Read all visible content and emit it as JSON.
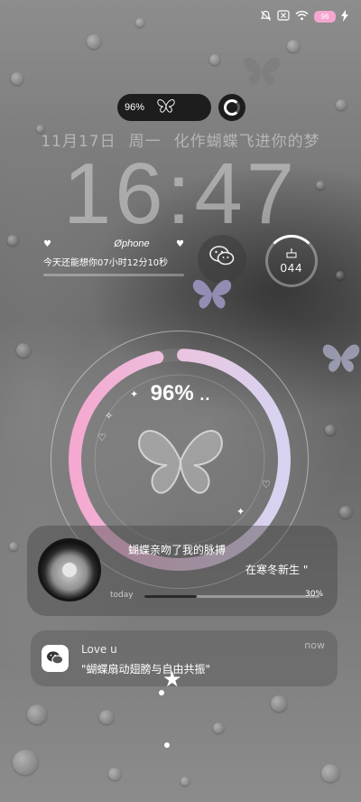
{
  "status_bar": {
    "icons": [
      "bell-muted-icon",
      "no-sim-icon",
      "wifi-icon",
      "battery-icon",
      "charging-icon"
    ],
    "battery_level": "96"
  },
  "pill": {
    "percent": "96%"
  },
  "date": {
    "date": "11月17日",
    "weekday": "周一",
    "slogan": "化作蝴蝶飞进你的梦"
  },
  "clock": {
    "time": "16:47"
  },
  "widget": {
    "title": "Øphone",
    "text": "今天还能想你07小时12分10秒"
  },
  "counter": {
    "value": "044"
  },
  "charging": {
    "percent": "96%",
    "dots": "..",
    "level": 0.96
  },
  "music": {
    "line1": "蝴蝶亲吻了我的脉搏",
    "line2": "在寒冬新生 \"",
    "today_label": "today",
    "progress_label": "30%",
    "progress": 0.3
  },
  "notification": {
    "title": "Love u",
    "body": "\"蝴蝶扇动翅膀与自由共振\"",
    "time": "now"
  },
  "colors": {
    "ring_pink": "#f5a8d0",
    "ring_lavender": "#d6d3f0",
    "battery_pink": "#f4a6cf"
  }
}
